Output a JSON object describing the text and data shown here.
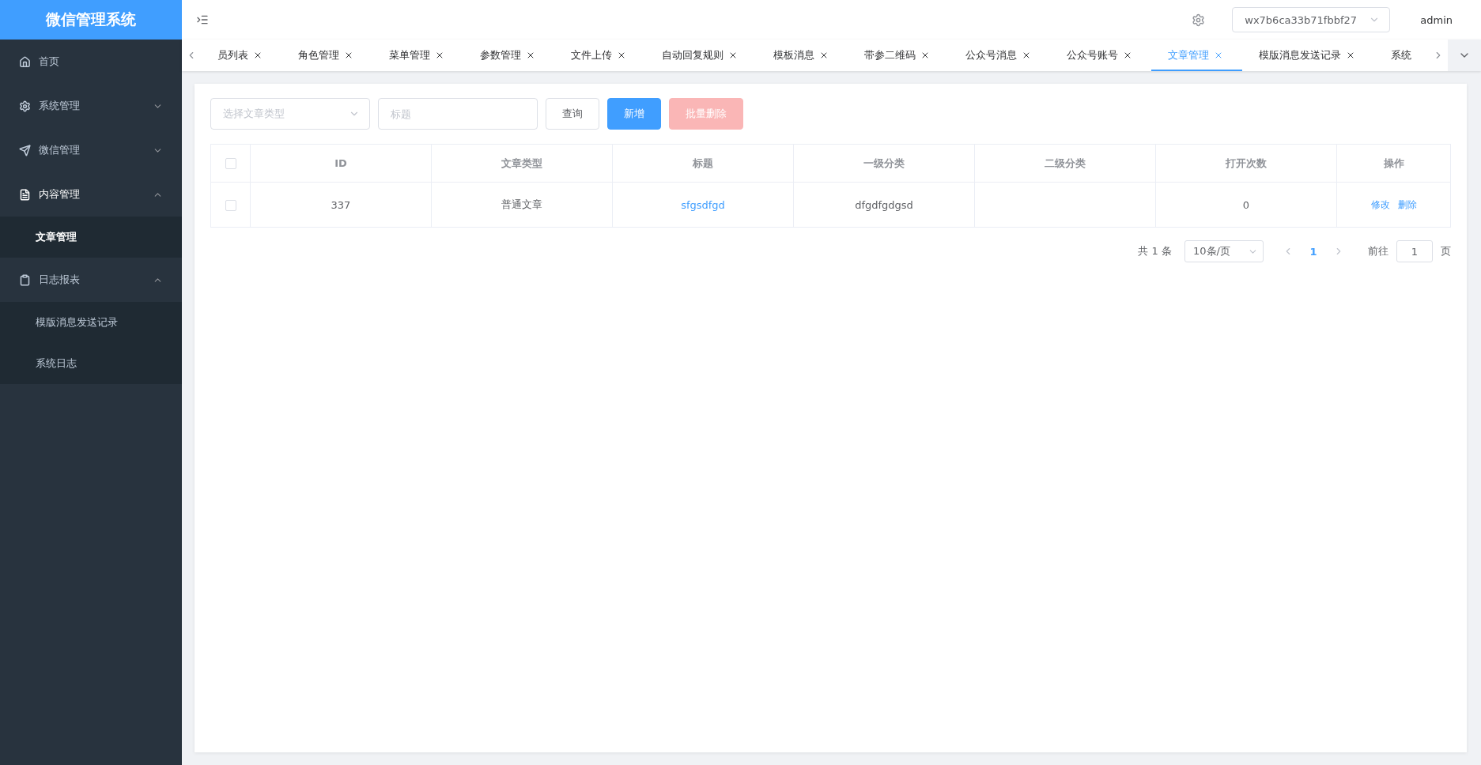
{
  "sidebar": {
    "logo": "微信管理系统",
    "items": [
      {
        "label": "首页"
      },
      {
        "label": "系统管理",
        "expanded": false
      },
      {
        "label": "微信管理",
        "expanded": false
      },
      {
        "label": "内容管理",
        "expanded": true,
        "children": [
          {
            "label": "文章管理",
            "selected": true
          }
        ]
      },
      {
        "label": "日志报表",
        "expanded": true,
        "children": [
          {
            "label": "模版消息发送记录",
            "selected": false
          },
          {
            "label": "系统日志",
            "selected": false
          }
        ]
      }
    ]
  },
  "header": {
    "account": "wx7b6ca33b71fbbf27",
    "user": "admin"
  },
  "tabs": [
    {
      "label": "员列表",
      "selected": false
    },
    {
      "label": "角色管理",
      "selected": false
    },
    {
      "label": "菜单管理",
      "selected": false
    },
    {
      "label": "参数管理",
      "selected": false
    },
    {
      "label": "文件上传",
      "selected": false
    },
    {
      "label": "自动回复规则",
      "selected": false
    },
    {
      "label": "模板消息",
      "selected": false
    },
    {
      "label": "带参二维码",
      "selected": false
    },
    {
      "label": "公众号消息",
      "selected": false
    },
    {
      "label": "公众号账号",
      "selected": false
    },
    {
      "label": "文章管理",
      "selected": true
    },
    {
      "label": "模版消息发送记录",
      "selected": false
    },
    {
      "label": "系统",
      "selected": false
    }
  ],
  "filters": {
    "type_placeholder": "选择文章类型",
    "title_placeholder": "标题"
  },
  "buttons": [
    {
      "label": "查询",
      "kind": "plain",
      "disabled": false
    },
    {
      "label": "新增",
      "kind": "primary",
      "disabled": false
    },
    {
      "label": "批量删除",
      "kind": "danger",
      "disabled": true
    }
  ],
  "table": {
    "columns": [
      "ID",
      "文章类型",
      "标题",
      "一级分类",
      "二级分类",
      "打开次数",
      "操作"
    ],
    "all_checked": false,
    "rows": [
      {
        "checked": false,
        "cells": [
          "337",
          "普通文章",
          "sfgsdfgd",
          "dfgdfgdgsd",
          "",
          "0"
        ],
        "actions": [
          "修改",
          "删除"
        ]
      }
    ]
  },
  "pagination": {
    "total": "共 1 条",
    "page_size": "10条/页",
    "pages": [
      {
        "label": "1",
        "selected": true
      }
    ],
    "goto_label": "前往",
    "goto_value": "1",
    "page_suffix": "页"
  }
}
